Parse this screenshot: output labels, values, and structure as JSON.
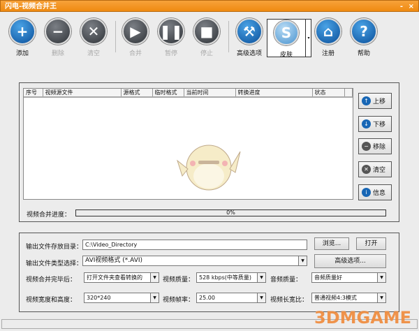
{
  "window": {
    "title": "闪电-视频合并王",
    "min": "-",
    "close": "×"
  },
  "toolbar": [
    {
      "label": "添加",
      "icon": "plus-icon",
      "enabled": true
    },
    {
      "label": "删除",
      "icon": "minus-icon",
      "enabled": false
    },
    {
      "label": "清空",
      "icon": "x-icon",
      "enabled": false
    },
    {
      "label": "合并",
      "icon": "play-icon",
      "enabled": false
    },
    {
      "label": "暂停",
      "icon": "pause-icon",
      "enabled": false
    },
    {
      "label": "停止",
      "icon": "stop-icon",
      "enabled": false
    },
    {
      "label": "高级选项",
      "icon": "tools-icon",
      "enabled": true
    },
    {
      "label": "皮肤",
      "icon": "skin-icon",
      "enabled": true
    },
    {
      "label": "注册",
      "icon": "home-icon",
      "enabled": true
    },
    {
      "label": "帮助",
      "icon": "help-icon",
      "enabled": true
    }
  ],
  "table": {
    "columns": [
      "序号",
      "视频源文件",
      "源格式",
      "临时格式",
      "当前时间",
      "转换进度",
      "状态"
    ],
    "rows": []
  },
  "side_buttons": [
    {
      "label": "上移",
      "icon": "arrow-up-icon"
    },
    {
      "label": "下移",
      "icon": "arrow-down-icon"
    },
    {
      "label": "移除",
      "icon": "minus-icon"
    },
    {
      "label": "清空",
      "icon": "x-icon"
    },
    {
      "label": "信息",
      "icon": "info-icon"
    }
  ],
  "progress": {
    "label": "视频合并进度：",
    "value": 0,
    "text": "0%"
  },
  "settings": {
    "output_dir_label": "输出文件存放目录：",
    "output_dir": "C:\\Video_Directory",
    "browse": "浏览...",
    "open": "打开",
    "type_label": "输出文件类型选择：",
    "type": "AVI视频格式 (*.AVI)",
    "advanced": "高级选项...",
    "after_label": "视频合并完毕后：",
    "after": "打开文件夹查看转换的",
    "vq_label": "视频质量：",
    "vq": "528 kbps(中等质量)",
    "aq_label": "音频质量：",
    "aq": "音频质量好",
    "size_label": "视频宽度和高度：",
    "size": "320*240",
    "fps_label": "视频帧率：",
    "fps": "25.00",
    "ratio_label": "视频长宽比：",
    "ratio": "普通视频4:3模式"
  },
  "watermark": "3DMGAME",
  "colors": {
    "title": "#ef8a10",
    "accent": "#0a4f9a"
  }
}
